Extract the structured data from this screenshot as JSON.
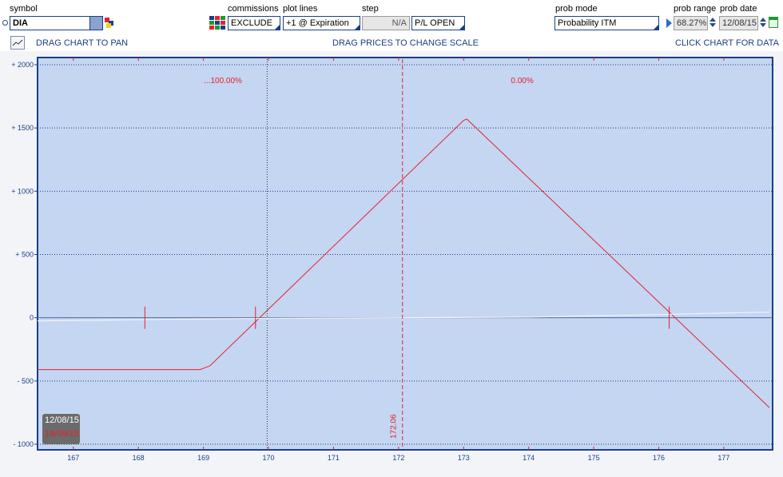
{
  "toolbar": {
    "symbol_label": "symbol",
    "symbol_value": "DIA",
    "commissions_label": "commissions",
    "commissions_value": "EXCLUDE",
    "plot_lines_label": "plot lines",
    "plot_lines_value": "+1 @ Expiration",
    "step_label": "step",
    "step_value": "N/A",
    "pl_mode_value": "P/L OPEN",
    "prob_mode_label": "prob mode",
    "prob_mode_value": "Probability ITM",
    "prob_range_label": "prob range",
    "prob_range_value": "68.27%",
    "prob_date_label": "prob date",
    "prob_date_value": "12/08/15"
  },
  "hints": {
    "pan": "DRAG CHART TO PAN",
    "scale": "DRAG PRICES TO CHANGE SCALE",
    "data": "CLICK CHART FOR DATA"
  },
  "date_badge": {
    "current": "12/08/15",
    "expiration": "19/09/15"
  },
  "colors": {
    "chart_bg": "#c4d6f2",
    "border": "#1b3f87",
    "pl_line": "#e8202a",
    "axis_text": "#1b3f87"
  },
  "chart_data": {
    "type": "line",
    "title": "",
    "xlabel": "",
    "ylabel": "",
    "xlim": [
      166.45,
      177.75
    ],
    "ylim": [
      -1000,
      2000
    ],
    "x_ticks": [
      167,
      168,
      169,
      170,
      171,
      172,
      173,
      174,
      175,
      176,
      177
    ],
    "y_ticks": [
      2000,
      1500,
      1000,
      500,
      0,
      -500,
      -1000
    ],
    "y_tick_labels": [
      "+ 2000",
      "+ 1500",
      "+ 1000",
      "+ 500",
      "0",
      "- 500",
      "- 1000"
    ],
    "grid": true,
    "series": [
      {
        "x": [
          166.45,
          168.95,
          169.1,
          173.0,
          173.05,
          177.7
        ],
        "y": [
          -410,
          -410,
          -380,
          1560,
          1570,
          -710
        ]
      },
      {
        "x": [
          166.45,
          168.0,
          170.0,
          172.0,
          174.0,
          176.0,
          177.7
        ],
        "y": [
          -25,
          -15,
          -5,
          0,
          5,
          25,
          45
        ]
      }
    ],
    "current_price": 172.06,
    "current_price_label": "172.06",
    "current_date_x": 169.98,
    "breakevens": [
      169.8,
      176.16
    ],
    "marker_price": 168.1,
    "annotations": [
      {
        "x": 169.3,
        "text": "...100.00%"
      },
      {
        "x": 173.9,
        "text": "0.00%"
      }
    ]
  }
}
